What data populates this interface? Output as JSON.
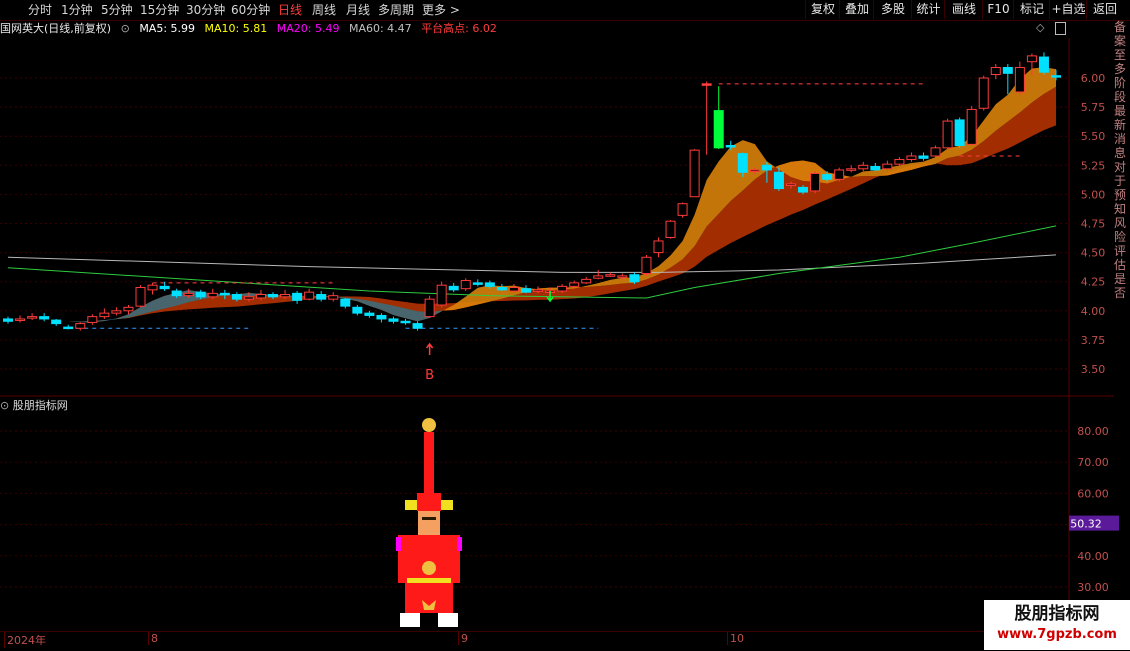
{
  "toolbar": {
    "periods": [
      "分时",
      "1分钟",
      "5分钟",
      "15分钟",
      "30分钟",
      "60分钟",
      "日线",
      "周线",
      "月线",
      "多周期",
      "更多 >"
    ],
    "active_period": "日线",
    "right_buttons": [
      "复权",
      "叠加",
      "多股",
      "统计",
      "画线",
      "F10",
      "标记",
      "+自选",
      "返回"
    ]
  },
  "info": {
    "stock": "国网英大(日线,前复权)",
    "ma5": "MA5: 5.99",
    "ma10": "MA10: 5.81",
    "ma20": "MA20: 5.49",
    "ma60": "MA60: 4.47",
    "platform": "平台高点: 6.02",
    "colors": {
      "ma5": "#ffffff",
      "ma10": "#ffff00",
      "ma20": "#ff00ff",
      "ma60": "#c0c0c0",
      "platform": "#ff3b3b"
    }
  },
  "right_column_text": "备案至多阶段最新消息对于预知风险评估是否",
  "price_axis": {
    "ticks": [
      "6.00",
      "5.75",
      "5.50",
      "5.25",
      "5.00",
      "4.75",
      "4.50",
      "4.25",
      "4.00",
      "3.75",
      "3.50"
    ]
  },
  "signal_label": "B",
  "sub_panel": {
    "title": "股朋指标网",
    "axis_ticks": [
      "80.00",
      "70.00",
      "60.00",
      "50.00",
      "40.00",
      "30.00"
    ],
    "current_value": "50.32"
  },
  "date_axis": [
    "2024年",
    "8",
    "9",
    "10"
  ],
  "watermark": {
    "title": "股朋指标网",
    "url": "www.7gpzb.com"
  },
  "chart_data": {
    "type": "candlestick",
    "ylim": [
      3.35,
      6.35
    ],
    "candles": [
      [
        3.93,
        3.91,
        3.95,
        3.89
      ],
      [
        3.92,
        3.93,
        3.96,
        3.9
      ],
      [
        3.94,
        3.95,
        3.98,
        3.92
      ],
      [
        3.95,
        3.93,
        3.98,
        3.91
      ],
      [
        3.92,
        3.89,
        3.93,
        3.87
      ],
      [
        3.86,
        3.85,
        3.88,
        3.84
      ],
      [
        3.85,
        3.89,
        3.9,
        3.83
      ],
      [
        3.9,
        3.95,
        3.97,
        3.88
      ],
      [
        3.95,
        3.98,
        4.02,
        3.93
      ],
      [
        3.98,
        4.0,
        4.03,
        3.96
      ],
      [
        4.0,
        4.03,
        4.05,
        3.97
      ],
      [
        4.04,
        4.2,
        4.22,
        4.03
      ],
      [
        4.18,
        4.22,
        4.24,
        4.14
      ],
      [
        4.21,
        4.19,
        4.25,
        4.17
      ],
      [
        4.17,
        4.13,
        4.19,
        4.11
      ],
      [
        4.13,
        4.15,
        4.19,
        4.11
      ],
      [
        4.16,
        4.12,
        4.18,
        4.1
      ],
      [
        4.12,
        4.15,
        4.19,
        4.1
      ],
      [
        4.15,
        4.14,
        4.18,
        4.1
      ],
      [
        4.14,
        4.1,
        4.16,
        4.08
      ],
      [
        4.1,
        4.12,
        4.16,
        4.08
      ],
      [
        4.11,
        4.14,
        4.18,
        4.09
      ],
      [
        4.14,
        4.12,
        4.16,
        4.1
      ],
      [
        4.12,
        4.14,
        4.18,
        4.1
      ],
      [
        4.15,
        4.09,
        4.17,
        4.06
      ],
      [
        4.1,
        4.16,
        4.19,
        4.09
      ],
      [
        4.14,
        4.1,
        4.17,
        4.08
      ],
      [
        4.1,
        4.13,
        4.16,
        4.08
      ],
      [
        4.1,
        4.04,
        4.11,
        4.02
      ],
      [
        4.03,
        3.98,
        4.05,
        3.96
      ],
      [
        3.98,
        3.96,
        4.0,
        3.94
      ],
      [
        3.96,
        3.93,
        3.98,
        3.9
      ],
      [
        3.93,
        3.91,
        3.95,
        3.89
      ],
      [
        3.91,
        3.9,
        3.93,
        3.88
      ],
      [
        3.89,
        3.85,
        3.91,
        3.83
      ],
      [
        3.95,
        4.1,
        4.13,
        3.94
      ],
      [
        4.05,
        4.22,
        4.25,
        4.03
      ],
      [
        4.21,
        4.18,
        4.24,
        4.16
      ],
      [
        4.19,
        4.26,
        4.28,
        4.17
      ],
      [
        4.24,
        4.23,
        4.27,
        4.21
      ],
      [
        4.24,
        4.21,
        4.26,
        4.19
      ],
      [
        4.2,
        4.18,
        4.23,
        4.17
      ],
      [
        4.17,
        4.2,
        4.23,
        4.16
      ],
      [
        4.19,
        4.16,
        4.22,
        4.15
      ],
      [
        4.18,
        4.18,
        4.21,
        4.15
      ],
      [
        4.17,
        4.17,
        4.2,
        4.14
      ],
      [
        4.17,
        4.21,
        4.23,
        4.15
      ],
      [
        4.21,
        4.24,
        4.26,
        4.2
      ],
      [
        4.24,
        4.27,
        4.29,
        4.23
      ],
      [
        4.28,
        4.3,
        4.35,
        4.27
      ],
      [
        4.3,
        4.31,
        4.33,
        4.29
      ],
      [
        4.29,
        4.3,
        4.32,
        4.27
      ],
      [
        4.31,
        4.25,
        4.33,
        4.23
      ],
      [
        4.32,
        4.46,
        4.48,
        4.3
      ],
      [
        4.5,
        4.6,
        4.63,
        4.46
      ],
      [
        4.63,
        4.77,
        4.78,
        4.62
      ],
      [
        4.82,
        4.92,
        4.93,
        4.8
      ],
      [
        4.98,
        5.38,
        5.39,
        5.16
      ],
      [
        5.95,
        5.95,
        5.97,
        5.34
      ],
      [
        5.72,
        5.4,
        5.93,
        5.39
      ],
      [
        5.42,
        5.41,
        5.46,
        5.38
      ],
      [
        5.35,
        5.19,
        5.36,
        5.15
      ],
      [
        5.21,
        5.21,
        5.23,
        5.17
      ],
      [
        5.25,
        5.21,
        5.28,
        5.1
      ],
      [
        5.19,
        5.05,
        5.23,
        5.03
      ],
      [
        5.09,
        5.09,
        5.11,
        5.05
      ],
      [
        5.06,
        5.02,
        5.08,
        5.0
      ],
      [
        5.03,
        5.18,
        5.2,
        5.01
      ],
      [
        5.17,
        5.13,
        5.2,
        5.11
      ],
      [
        5.13,
        5.21,
        5.23,
        5.11
      ],
      [
        5.21,
        5.22,
        5.25,
        5.19
      ],
      [
        5.22,
        5.25,
        5.28,
        5.2
      ],
      [
        5.24,
        5.21,
        5.27,
        5.2
      ],
      [
        5.22,
        5.26,
        5.29,
        5.2
      ],
      [
        5.26,
        5.3,
        5.32,
        5.24
      ],
      [
        5.3,
        5.33,
        5.36,
        5.28
      ],
      [
        5.33,
        5.31,
        5.36,
        5.29
      ],
      [
        5.33,
        5.4,
        5.42,
        5.31
      ],
      [
        5.4,
        5.63,
        5.65,
        5.38
      ],
      [
        5.64,
        5.42,
        5.66,
        5.4
      ],
      [
        5.43,
        5.73,
        5.76,
        5.42
      ],
      [
        5.74,
        6.0,
        6.02,
        5.72
      ],
      [
        6.03,
        6.09,
        6.12,
        5.99
      ],
      [
        6.09,
        6.04,
        6.12,
        5.86
      ],
      [
        5.88,
        6.09,
        6.14,
        5.85
      ],
      [
        6.14,
        6.19,
        6.21,
        6.02
      ],
      [
        6.18,
        6.05,
        6.22,
        6.03
      ],
      [
        6.02,
        6.01,
        6.07,
        5.98
      ]
    ]
  }
}
